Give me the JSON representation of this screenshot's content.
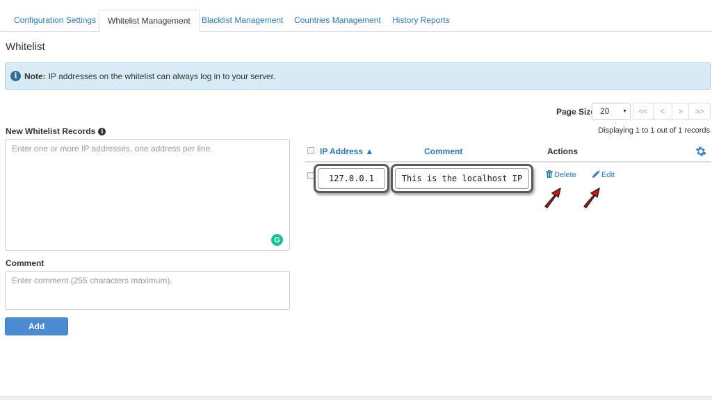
{
  "tabs": [
    {
      "label": "Configuration Settings"
    },
    {
      "label": "Whitelist Management"
    },
    {
      "label": "Blacklist Management"
    },
    {
      "label": "Countries Management"
    },
    {
      "label": "History Reports"
    }
  ],
  "active_tab": "Whitelist Management",
  "page_title": "Whitelist",
  "alert": {
    "icon": "info-circle-icon",
    "strong": "Note:",
    "text": "IP addresses on the whitelist can always log in to your server."
  },
  "form": {
    "records_label": "New Whitelist Records",
    "records_placeholder": "Enter one or more IP addresses, one address per line.",
    "comment_label": "Comment",
    "comment_placeholder": "Enter comment (255 characters maximum).",
    "add_button": "Add"
  },
  "pagination": {
    "page_size_label": "Page Size",
    "page_size": "20",
    "first": "<<",
    "prev": "<",
    "next": ">",
    "last": ">>",
    "displaying": "Displaying 1 to 1 out of 1 records"
  },
  "table": {
    "headers": {
      "ip": "IP Address ▲",
      "comment": "Comment",
      "actions": "Actions"
    },
    "rows": [
      {
        "ip": "127.0.0.1",
        "comment": "This is the localhost IP",
        "delete": "Delete",
        "edit": "Edit"
      }
    ]
  },
  "colors": {
    "link": "#2a7ab8",
    "alert_bg": "#d8ecf6",
    "button": "#4a8ccf",
    "annotation_arrow": "#e01010"
  }
}
